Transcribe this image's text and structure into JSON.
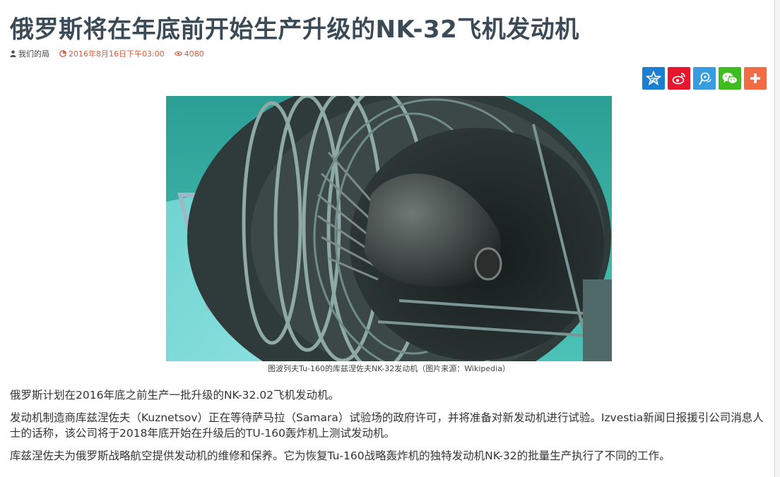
{
  "article": {
    "title": "俄罗斯将在年底前开始生产升级的NK-32飞机发动机",
    "meta": {
      "author": "我们的局",
      "date": "2016年8月16日下午03:00",
      "views": "4080"
    },
    "image_caption": "图波列夫Tu-160的库兹涅佐夫NK-32发动机（图片来源：Wikipedia）",
    "paragraphs": [
      "俄罗斯计划在2016年底之前生产一批升级的NK-32.02飞机发动机。",
      "发动机制造商库兹涅佐夫（Kuznetsov）正在等待萨马拉（Samara）试验场的政府许可，并将准备对新发动机进行试验。Izvestia新闻日报援引公司消息人士的话称，该公司将于2018年底开始在升级后的TU-160轰炸机上测试发动机。",
      "库兹涅佐夫为俄罗斯战略航空提供发动机的维修和保养。它为恢复Tu-160战略轰炸机的独特发动机NK-32的批量生产执行了不同的工作。"
    ]
  },
  "share_buttons": [
    {
      "icon": "qzone-star-icon",
      "color": "#1a7fd1"
    },
    {
      "icon": "weibo-icon",
      "color": "#e6162d"
    },
    {
      "icon": "tencent-weibo-icon",
      "color": "#3a9ce0"
    },
    {
      "icon": "wechat-icon",
      "color": "#3fbc1f"
    },
    {
      "icon": "plus-icon",
      "color": "#f16b45"
    }
  ],
  "colors": {
    "title": "#3a4a56",
    "meta_accent": "#e05a3a"
  }
}
